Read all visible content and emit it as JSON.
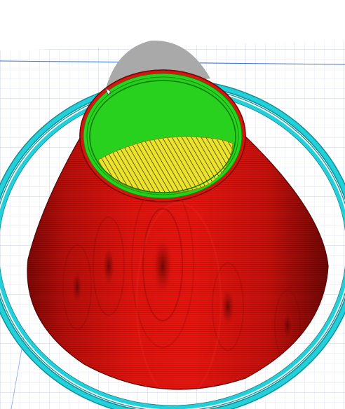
{
  "view": {
    "kind": "3d-slicer-layer-preview",
    "object_shape": "truncated-cone"
  },
  "colors": {
    "background": "#ffffff",
    "build_plate_grid": "#dde2e8",
    "build_plate_grid_dark": "#c9d0d8",
    "plate_edge_line": "#3a6fd8",
    "skirt": "#22ccd6",
    "skirt_dark": "#0f8f99",
    "outer_wall": "#d8150f",
    "outer_wall_dark": "#8c0a08",
    "inner_wall": "#28d21d",
    "inner_wall_dark": "#138a0e",
    "top_bottom_infill": "#e8e22a",
    "travel_shadow": "#a7a7a7"
  },
  "legend": {
    "outer_wall_meaning": "outer-wall",
    "inner_wall_meaning": "inner-wall",
    "infill_meaning": "top-bottom",
    "skirt_meaning": "skirt"
  }
}
